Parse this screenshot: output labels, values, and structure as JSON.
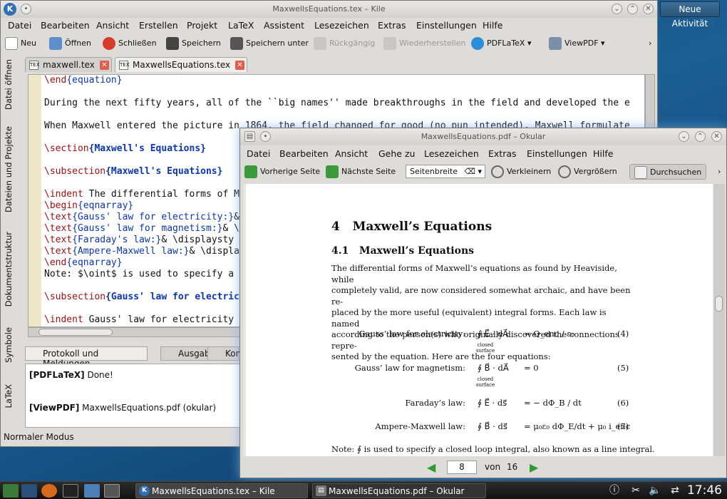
{
  "desktop": {
    "activity_button": "Neue Aktivität"
  },
  "kile": {
    "title": "MaxwellsEquations.tex – Kile",
    "menu": [
      "Datei",
      "Bearbeiten",
      "Ansicht",
      "Erstellen",
      "Projekt",
      "LaTeX",
      "Assistent",
      "Lesezeichen",
      "Extras",
      "Einstellungen",
      "Hilfe"
    ],
    "toolbar": {
      "new": "Neu",
      "open": "Öffnen",
      "close": "Schließen",
      "save": "Speichern",
      "save_as": "Speichern unter",
      "undo": "Rückgängig",
      "redo": "Wiederherstellen",
      "pdflatex": "PDFLaTeX",
      "viewpdf": "ViewPDF",
      "more": "›"
    },
    "side_tabs": [
      "Datei öffnen",
      "Dateien und Projekte",
      "Dokumentstruktur",
      "Symbole",
      "LaTeX"
    ],
    "tabs": [
      {
        "label": "maxwell.tex"
      },
      {
        "label": "MaxwellsEquations.tex"
      }
    ],
    "code": [
      {
        "kw": "\\end",
        "arg": "{equation}",
        "rest": ""
      },
      {
        "kw": "",
        "arg": "",
        "rest": ""
      },
      {
        "kw": "",
        "arg": "",
        "rest": "During the next fifty years, all of the ``big names'' made breakthroughs in the field and developed the e"
      },
      {
        "kw": "",
        "arg": "",
        "rest": ""
      },
      {
        "kw": "",
        "arg": "",
        "rest": "When Maxwell entered the picture in 1864, the field changed for good (no pun intended). Maxwell formulate"
      },
      {
        "kw": "",
        "arg": "",
        "rest": ""
      },
      {
        "kw": "\\section",
        "arg": "{Maxwell's Equations}",
        "rest": ""
      },
      {
        "kw": "",
        "arg": "",
        "rest": ""
      },
      {
        "kw": "\\subsection",
        "arg": "{Maxwell's Equations}",
        "rest": ""
      },
      {
        "kw": "",
        "arg": "",
        "rest": ""
      },
      {
        "kw": "\\indent",
        "arg": "",
        "rest": " The differential forms of M"
      },
      {
        "kw": "\\begin",
        "arg": "{eqnarray}",
        "rest": ""
      },
      {
        "kw": "\\text",
        "arg": "{Gauss' law for electricity:}",
        "rest": "&"
      },
      {
        "kw": "\\text",
        "arg": "{Gauss' law for magnetism:}",
        "rest": "& \\"
      },
      {
        "kw": "\\text",
        "arg": "{Faraday's law:}",
        "rest": "& \\displaysty"
      },
      {
        "kw": "\\text",
        "arg": "{Ampere-Maxwell law:}",
        "rest": "& \\displa"
      },
      {
        "kw": "\\end",
        "arg": "{eqnarray}",
        "rest": ""
      },
      {
        "kw": "",
        "arg": "",
        "rest": "Note: $\\oint$ is used to specify a"
      },
      {
        "kw": "",
        "arg": "",
        "rest": ""
      },
      {
        "kw": "\\subsection",
        "arg": "{Gauss' law for electric",
        "rest": ""
      },
      {
        "kw": "",
        "arg": "",
        "rest": ""
      },
      {
        "kw": "\\indent",
        "arg": "",
        "rest": " Gauss' law for electricity"
      }
    ],
    "bottom_tabs": [
      "Protokoll und Meldungen",
      "Ausgabe",
      "Kon"
    ],
    "log": [
      {
        "tag": "[PDFLaTeX]",
        "msg": " Done!"
      },
      {
        "tag": "[ViewPDF]",
        "msg": " MaxwellsEquations.pdf (okular)"
      }
    ],
    "status": "Normaler Modus"
  },
  "okular": {
    "title": "MaxwellsEquations.pdf – Okular",
    "menu": [
      "Datei",
      "Bearbeiten",
      "Ansicht",
      "Gehe zu",
      "Lesezeichen",
      "Extras",
      "Einstellungen",
      "Hilfe"
    ],
    "toolbar": {
      "prev": "Vorherige Seite",
      "next": "Nächste Seite",
      "zoom_mode": "Seitenbreite",
      "zoom_out": "Verkleinern",
      "zoom_in": "Vergrößern",
      "browse": "Durchsuchen",
      "more": "›"
    },
    "page": {
      "section_num": "4",
      "section": "Maxwell’s Equations",
      "subsection_num": "4.1",
      "subsection": "Maxwell’s Equations",
      "para": [
        "The differential forms of Maxwell’s equations as found by Heaviside, while",
        "completely valid, are now considered somewhat archaic, and have been re-",
        "placed by the more useful (equivalent) integral forms. Each law is named",
        "according to the person(s) who originally discovered the connections repre-",
        "sented by the equation. Here are the four equations:"
      ],
      "equations": [
        {
          "label": "Gauss’ law for electricity:",
          "lhs": "∮ E⃗ · dA⃗",
          "rhs": "= Q_enc / ε₀",
          "num": "(4)",
          "sub": "closed surface"
        },
        {
          "label": "Gauss’ law for magnetism:",
          "lhs": "∮ B⃗ · dA⃗",
          "rhs": "= 0",
          "num": "(5)",
          "sub": "closed surface"
        },
        {
          "label": "Faraday’s law:",
          "lhs": "∮ E⃗ · ds⃗",
          "rhs": "= − dΦ_B / dt",
          "num": "(6)",
          "sub": ""
        },
        {
          "label": "Ampere-Maxwell law:",
          "lhs": "∮ B⃗ · ds⃗",
          "rhs": "= μ₀ε₀ dΦ_E/dt + μ₀ i_enc",
          "num": "(7)",
          "sub": ""
        }
      ],
      "note": "Note: ∮ is used to specify a closed loop integral, also known as a line integral."
    },
    "nav": {
      "current": "8",
      "of": "von",
      "total": "16"
    }
  },
  "taskbar": {
    "tasks": [
      {
        "label": "MaxwellsEquations.tex – Kile"
      },
      {
        "label": "MaxwellsEquations.pdf – Okular"
      }
    ],
    "clock": "17:46"
  }
}
